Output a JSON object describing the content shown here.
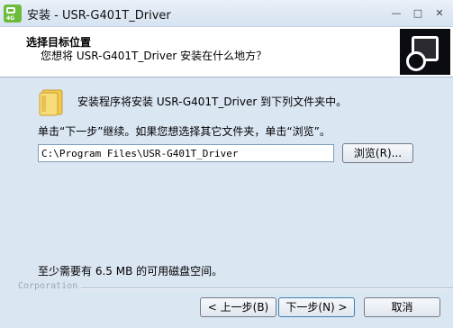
{
  "window": {
    "title": "安装 - USR-G401T_Driver",
    "minimize_glyph": "—",
    "maximize_glyph": "□",
    "close_glyph": "✕"
  },
  "header": {
    "title": "选择目标位置",
    "subtitle": "您想将 USR-G401T_Driver 安装在什么地方？",
    "image_icon": "installer-box-icon"
  },
  "content": {
    "intro": "安装程序将安装 USR-G401T_Driver 到下列文件夹中。",
    "instruction": "单击“下一步”继续。如果您想选择其它文件夹，单击“浏览”。",
    "path_value": "C:\\Program Files\\USR-G401T_Driver",
    "browse_label": "浏览(R)...",
    "space_required": "至少需要有 6.5 MB 的可用磁盘空间。",
    "folder_icon": "folder-icon"
  },
  "footer": {
    "branding": "Corporation",
    "back_label": "< 上一步(B)",
    "next_label": "下一步(N) >",
    "cancel_label": "取消"
  },
  "colors": {
    "background": "#dbe6f3",
    "header_bg": "#ffffff",
    "app_icon_green": "#6cbb3c",
    "folder_yellow": "#f2c94c"
  }
}
